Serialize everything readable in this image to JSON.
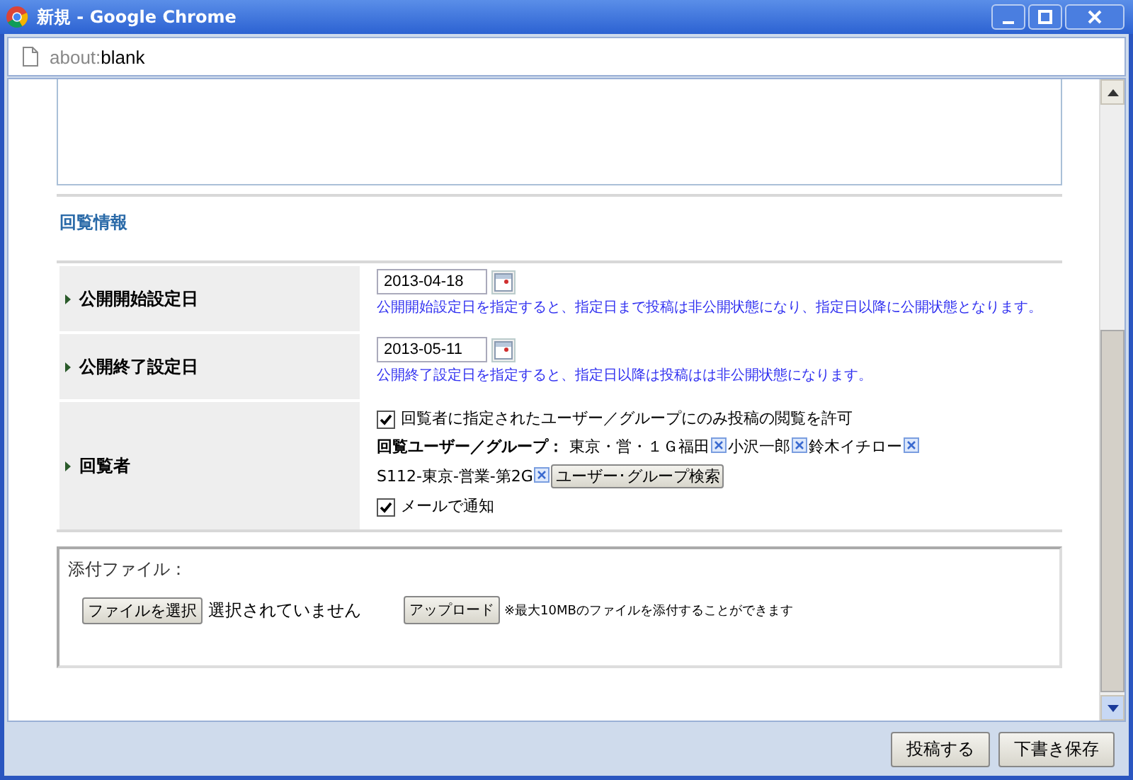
{
  "window": {
    "title": "新規 - Google Chrome"
  },
  "address_bar": {
    "scheme": "about:",
    "path": "blank"
  },
  "section_title": "回覧情報",
  "rows": [
    {
      "kind": "date",
      "label": "公開開始設定日",
      "value": "2013-04-18",
      "hint": "公開開始設定日を指定すると、指定日まで投稿は非公開状態になり、指定日以降に公開状態となります。"
    },
    {
      "kind": "date",
      "label": "公開終了設定日",
      "value": "2013-05-11",
      "hint": "公開終了設定日を指定すると、指定日以降は投稿はは非公開状態になります。"
    },
    {
      "kind": "viewers",
      "label": "回覧者",
      "restrict": {
        "label": "回覧者に指定されたユーザー／グループにのみ投稿の閲覧を許可",
        "checked": true
      },
      "members_label": "回覧ユーザー／グループ：",
      "members": [
        "東京・営・１Ｇ福田",
        "小沢一郎",
        "鈴木イチロー",
        "S112-東京-営業-第2G"
      ],
      "search_button": "ユーザー･グループ検索",
      "notify": {
        "label": "メールで通知",
        "checked": true
      }
    }
  ],
  "attachment": {
    "legend": "添付ファイル：",
    "choose_button": "ファイルを選択",
    "file_status": "選択されていません",
    "upload_button": "アップロード",
    "note": "※最大10MBのファイルを添付することができます"
  },
  "footer_buttons": [
    "投稿する",
    "下書き保存"
  ]
}
